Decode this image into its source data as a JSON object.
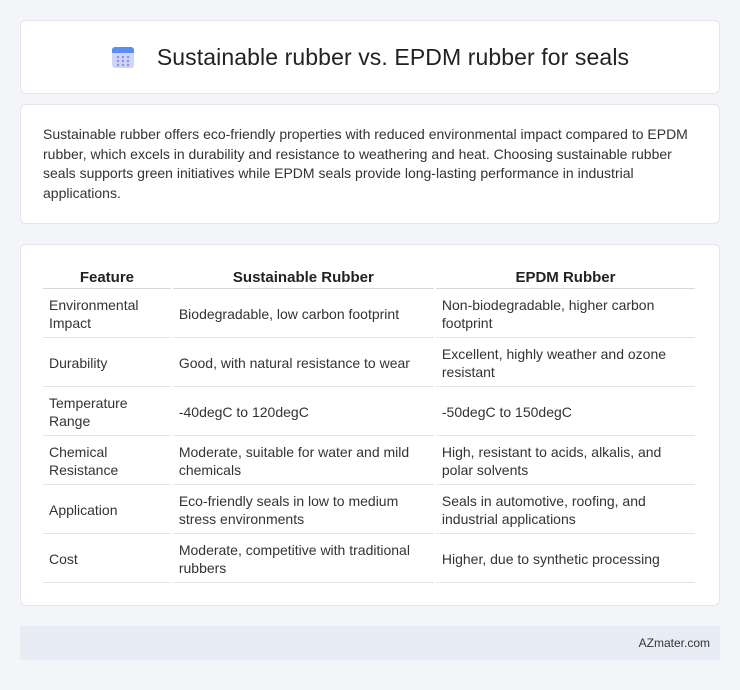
{
  "header": {
    "title": "Sustainable rubber vs. EPDM rubber for seals",
    "icon": "calendar-icon",
    "icon_colors": {
      "top": "#5b8ef0",
      "body": "#cdd8f7",
      "dots": "#9a8fe6"
    }
  },
  "intro": {
    "text": "Sustainable rubber offers eco-friendly properties with reduced environmental impact compared to EPDM rubber, which excels in durability and resistance to weathering and heat. Choosing sustainable rubber seals supports green initiatives while EPDM seals provide long-lasting performance in industrial applications."
  },
  "table": {
    "headers": [
      "Feature",
      "Sustainable Rubber",
      "EPDM Rubber"
    ],
    "rows": [
      [
        "Environmental Impact",
        "Biodegradable, low carbon footprint",
        "Non-biodegradable, higher carbon footprint"
      ],
      [
        "Durability",
        "Good, with natural resistance to wear",
        "Excellent, highly weather and ozone resistant"
      ],
      [
        "Temperature Range",
        "-40degC to 120degC",
        "-50degC to 150degC"
      ],
      [
        "Chemical Resistance",
        "Moderate, suitable for water and mild chemicals",
        "High, resistant to acids, alkalis, and polar solvents"
      ],
      [
        "Application",
        "Eco-friendly seals in low to medium stress environments",
        "Seals in automotive, roofing, and industrial applications"
      ],
      [
        "Cost",
        "Moderate, competitive with traditional rubbers",
        "Higher, due to synthetic processing"
      ]
    ]
  },
  "footer": {
    "text": "AZmater.com"
  }
}
